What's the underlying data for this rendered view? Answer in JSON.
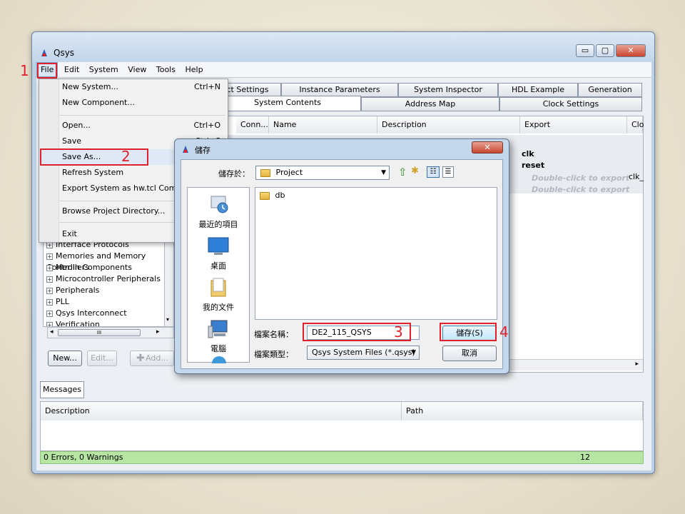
{
  "window": {
    "title": "Qsys",
    "minimize": "▭",
    "maximize": "▢",
    "close": "✕"
  },
  "menubar": [
    "File",
    "Edit",
    "System",
    "View",
    "Tools",
    "Help"
  ],
  "top_tabs": [
    "ct Settings",
    "Instance Parameters",
    "System Inspector",
    "HDL Example",
    "Generation"
  ],
  "sub_tabs": [
    "System Contents",
    "Address Map",
    "Clock Settings"
  ],
  "table": {
    "headers": [
      "Conn...",
      "Name",
      "Description",
      "Export",
      "Clo"
    ],
    "export_rows": [
      "clk",
      "reset",
      "Double-click to export",
      "Double-click to export"
    ],
    "clock_cell": "clk_"
  },
  "file_menu": {
    "items": [
      {
        "label": "New System...",
        "shortcut": "Ctrl+N"
      },
      {
        "label": "New Component...",
        "shortcut": ""
      },
      {
        "label": "Open...",
        "shortcut": "Ctrl+O"
      },
      {
        "label": "Save",
        "shortcut": "Ctrl+S"
      },
      {
        "label": "Save As...",
        "shortcut": ""
      },
      {
        "label": "Refresh System",
        "shortcut": ""
      },
      {
        "label": "Export System as hw.tcl Component...",
        "shortcut": ""
      },
      {
        "label": "Browse Project Directory...",
        "shortcut": ""
      },
      {
        "label": "Exit",
        "shortcut": ""
      }
    ]
  },
  "library": [
    "Interface Protocols",
    "Memories and Memory Controllers",
    "Merlin Components",
    "Microcontroller Peripherals",
    "Peripherals",
    "PLL",
    "Qsys Interconnect",
    "Verification"
  ],
  "library_buttons": {
    "new": "New...",
    "edit": "Edit...",
    "add": "Add..."
  },
  "messages": {
    "tab": "Messages",
    "headers": [
      "Description",
      "Path"
    ],
    "status": "0 Errors, 0 Warnings",
    "count": "12"
  },
  "dialog": {
    "title": "儲存",
    "save_in_label": "儲存於：",
    "save_in_value": "Project",
    "places": [
      "最近的項目",
      "桌面",
      "我的文件",
      "電腦"
    ],
    "files": [
      "db"
    ],
    "filename_label": "檔案名稱：",
    "filename_value": "DE2_115_QSYS",
    "filetype_label": "檔案類型：",
    "filetype_value": "Qsys System Files (*.qsys)",
    "save_button": "儲存(S)",
    "cancel_button": "取消"
  },
  "annotations": [
    "1",
    "2",
    "3",
    "4"
  ],
  "colors": {
    "annotation_red": "#e0202a",
    "status_green": "#b7e6a4",
    "window_frame": "#bcd0e6"
  }
}
